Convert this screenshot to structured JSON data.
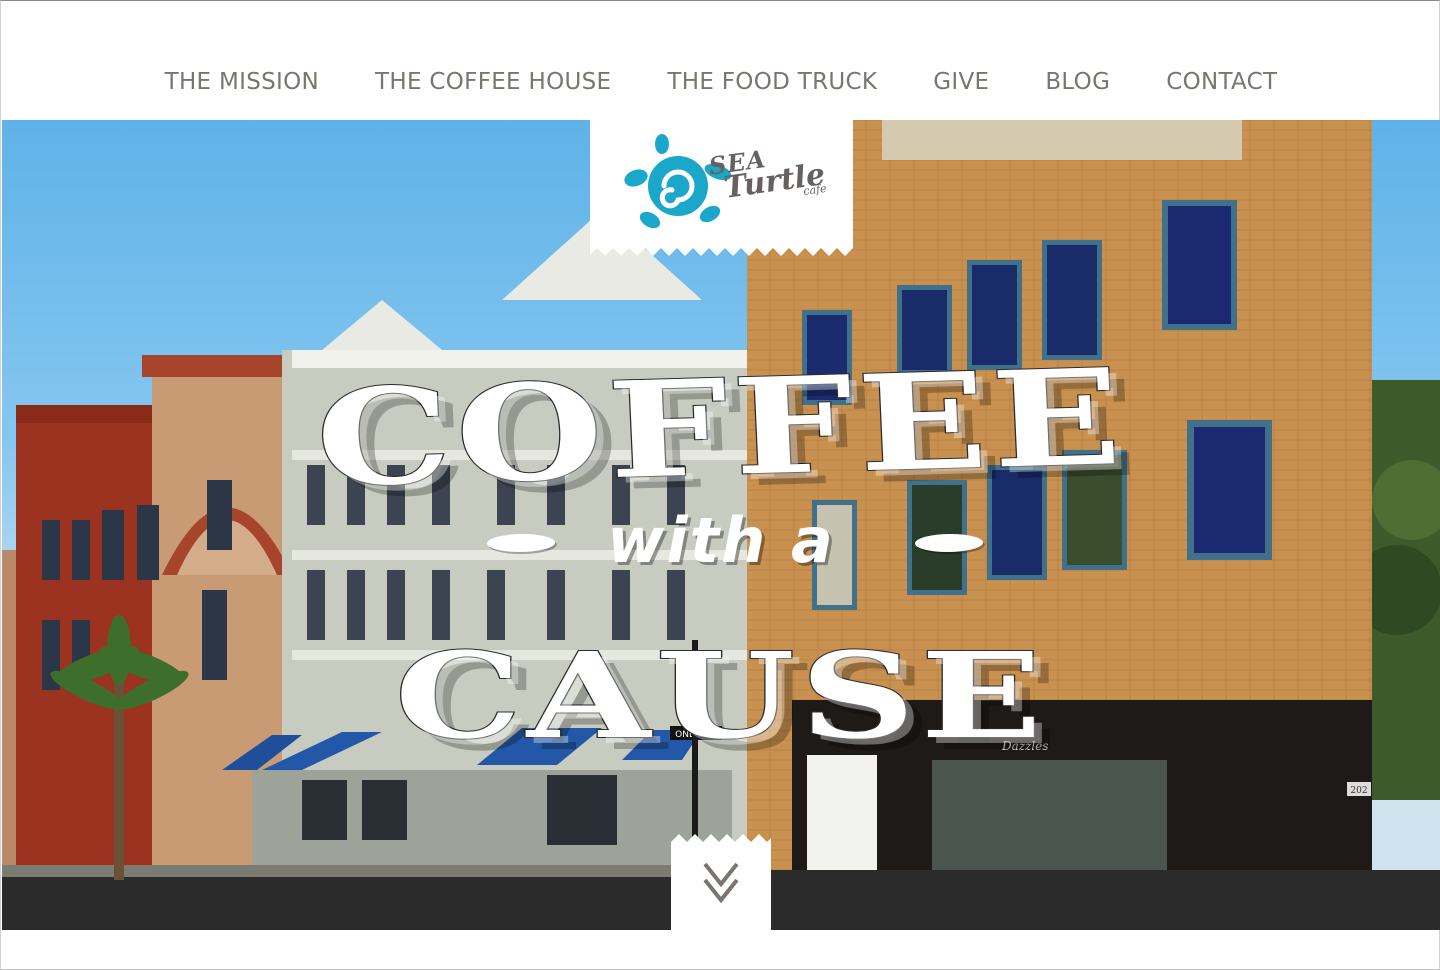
{
  "nav": {
    "items": [
      "THE MISSION",
      "THE COFFEE HOUSE",
      "THE FOOD TRUCK",
      "GIVE",
      "BLOG",
      "CONTACT"
    ]
  },
  "brand": {
    "logo_icon": "sea-turtle-icon",
    "logo_word_1": "SEA",
    "logo_word_2": "Turtle",
    "logo_word_3": "cafe",
    "logo_color": "#1ba7c9"
  },
  "hero": {
    "headline_top": "COFFEE",
    "headline_mid": "with a",
    "headline_bottom": "CAUSE",
    "scroll_icon": "double-chevron-down-icon",
    "sign_text": "ONE WAY",
    "storefront_sign": "Dazzles",
    "address_number": "202"
  }
}
